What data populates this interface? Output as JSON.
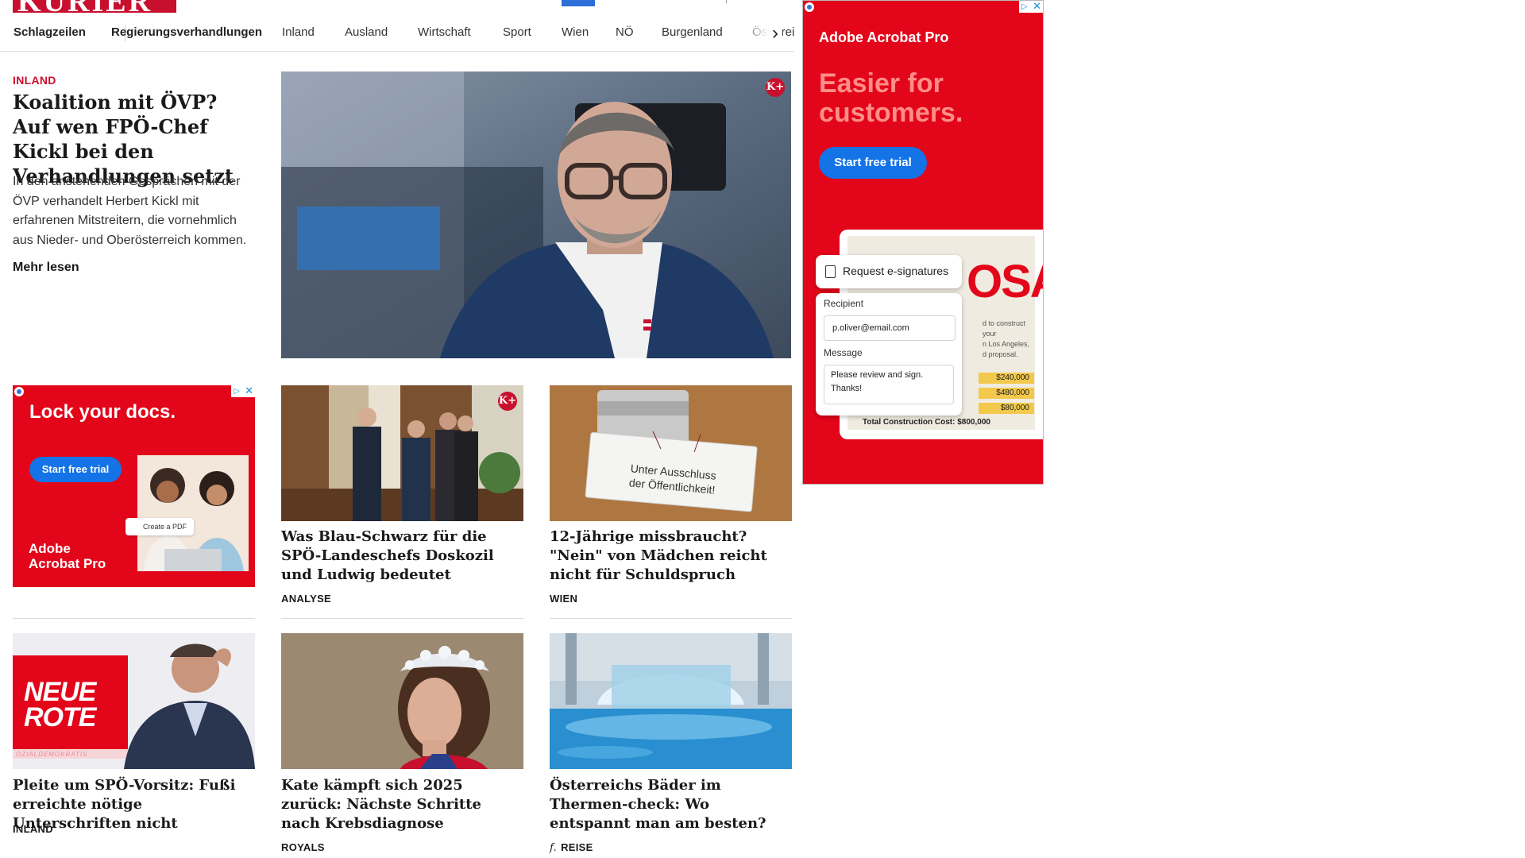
{
  "brand": {
    "logo": "KURIER"
  },
  "nav": {
    "items": [
      "Schlagzeilen",
      "Regierungsverhandlungen",
      "Inland",
      "Ausland",
      "Wirtschaft",
      "Sport",
      "Wien",
      "NÖ",
      "Burgenland",
      "Österreich"
    ],
    "next_icon": "chevron-right-icon"
  },
  "lead": {
    "kicker": "INLAND",
    "title": "Koalition mit ÖVP? Auf wen FPÖ-Chef Kickl bei den Verhandlungen setzt",
    "teaser": "In den anstehenden Gesprächen mit der ÖVP verhandelt Herbert Kickl mit erfahrenen Mitstreitern, die vornehmlich aus Nieder- und Oberösterreich kommen.",
    "more": "Mehr lesen",
    "premium_badge": "K+"
  },
  "cards": [
    {
      "title": "Was Blau-Schwarz für die SPÖ-Landeschefs Doskozil und Ludwig bedeutet",
      "category": "ANALYSE",
      "premium_badge": "K+"
    },
    {
      "title": "12-Jährige missbraucht? \"Nein\" von Mädchen reicht nicht für Schuldspruch",
      "category": "WIEN",
      "sign_line1": "Unter Ausschluss",
      "sign_line2": "der Öffentlichkeit!"
    },
    {
      "title": "Pleite um SPÖ-Vorsitz: Fußi er­reichte nötige Unterschriften nicht",
      "category": "INLAND",
      "banner_line1": "NEUE",
      "banner_line2": "ROTE",
      "banner_sub": "OZIALDEMOKRATIS"
    },
    {
      "title": "Kate kämpft sich 2025 zurück: Nächste Schritte nach Krebsdiagnose",
      "category": "ROYALS"
    },
    {
      "title": "Österreichs Bäder im Thermen-check: Wo entspannt man am besten?",
      "category": "REISE",
      "category_icon": "f."
    }
  ],
  "ads": {
    "left": {
      "headline": "Lock your docs.",
      "cta": "Start free trial",
      "chip": "Create a PDF",
      "brand_line1": "Adobe",
      "brand_line2": "Acrobat Pro"
    },
    "right": {
      "brand": "Adobe Acrobat Pro",
      "headline_line1": "Easier for",
      "headline_line2": "customers.",
      "cta": "Start free trial",
      "doc_big": "OSAL",
      "doc_text_1": "d to construct your",
      "doc_text_2": "n Los Angeles,",
      "doc_text_3": "d proposal.",
      "amounts": [
        "$240,000",
        "$480,000",
        "$80,000"
      ],
      "total": "Total Construction Cost: $800,000",
      "panel_title": "Request e-signatures",
      "recipient_label": "Recipient",
      "recipient_value": "p.oliver@email.com",
      "message_label": "Message",
      "message_value": "Please review and sign. Thanks!"
    }
  },
  "colors": {
    "brand_red": "#c8102e",
    "ad_red": "#e3051a",
    "ad_blue": "#1473e6"
  }
}
